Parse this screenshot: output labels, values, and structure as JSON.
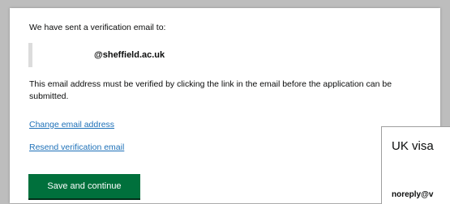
{
  "verification": {
    "intro": "We have sent a verification email to:",
    "email_suffix": "@sheffield.ac.uk",
    "note": "This email address must be verified by clicking the link in the email before the application can be submitted.",
    "change_email_link": "Change email address",
    "resend_link": "Resend verification email",
    "save_button": "Save and continue"
  },
  "overlay": {
    "title": "UK visa",
    "sender": "noreply@v"
  },
  "colors": {
    "link": "#1d70b8",
    "button": "#00703c",
    "text": "#0b0c0c",
    "backdrop": "#bdbdbd"
  }
}
